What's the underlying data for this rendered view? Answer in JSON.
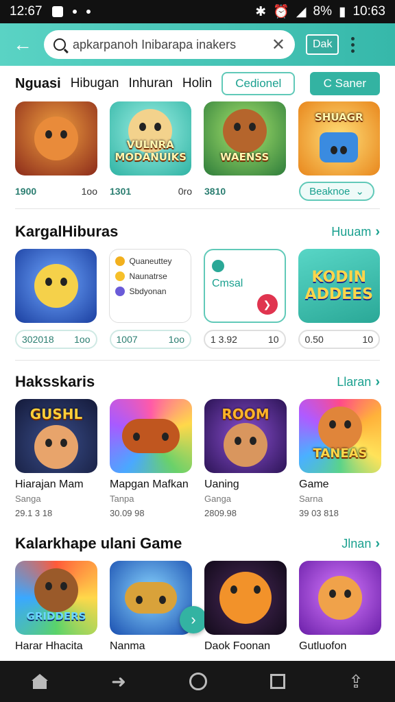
{
  "status_bar": {
    "time": "12:67",
    "right_time": "10:63",
    "battery": "8%"
  },
  "app_bar": {
    "search_text": "apkarpanoh Inibarapa inakers",
    "data_label": "Dak"
  },
  "top_section": {
    "title": "Nguasi",
    "tabs": [
      "Hibugan",
      "Inhuran",
      "Holin"
    ],
    "pill_outline": "Cedionel",
    "pill_solid": "C Saner",
    "games": [
      {
        "icon": "fox-mascot-icon",
        "bg": "#c23b2b",
        "banner": ""
      },
      {
        "icon": "puppy-mascot-icon",
        "bg": "#4ccbc0",
        "banner": "VULNRA MODANUIKS"
      },
      {
        "icon": "bear-mascot-icon",
        "bg": "#56a83a",
        "banner": "WAENSS"
      },
      {
        "icon": "robot-console-icon",
        "bg": "#f6a21b",
        "banner": "SHUAGR"
      }
    ],
    "meta": [
      {
        "value": "1900",
        "count": "1oo"
      },
      {
        "value": "1301",
        "count": "0ro"
      },
      {
        "value": "3810",
        "count": ""
      }
    ],
    "dropdown_label": "Beaknoe"
  },
  "section_kargal": {
    "title": "KargalHiburas",
    "see_all": "Huuam",
    "list_card_items": [
      "Quaneuttey",
      "Naunatrse",
      "Sbdyonan"
    ],
    "green_card_text": "Cmsal",
    "logo_card_text": "KODIN ADDEES",
    "chips": [
      {
        "value": "302018",
        "count": "1oo"
      },
      {
        "value": "1007",
        "count": "1oo"
      },
      {
        "value": "1 3.92",
        "count": "10"
      },
      {
        "value": "0.50",
        "count": "10"
      }
    ]
  },
  "section_hakss": {
    "title": "Haksskaris",
    "see_all": "Llaran",
    "games": [
      {
        "icon": "kids-group-icon",
        "bg": "#1f2a55",
        "banner": "GUSHL",
        "title": "Hiarajan Mam",
        "sub": "Sanga",
        "size": "29.1 3 18"
      },
      {
        "icon": "gamepad-icon",
        "bg": "#9a4bd6",
        "banner": "",
        "title": "Mapgan Mafkan",
        "sub": "Tanpa",
        "size": "30.09 98"
      },
      {
        "icon": "police-duo-icon",
        "bg": "#5b2a86",
        "banner": "ROOM",
        "title": "Uaning",
        "sub": "Ganga",
        "size": "2809.98"
      },
      {
        "icon": "bear-dancer-icon",
        "bg": "#e6377a",
        "banner": "TANEAS",
        "title": "Game",
        "sub": "Sarna",
        "size": "39 03 818"
      }
    ]
  },
  "section_kalar": {
    "title": "Kalarkhape ulani Game",
    "see_all": "Jlnan",
    "games": [
      {
        "icon": "bear-pilot-icon",
        "bg": "#e8402f",
        "banner": "GRIDDERS",
        "title": "Harar Hhacita"
      },
      {
        "icon": "ufo-icon",
        "bg": "#2a7fd4",
        "banner": "",
        "title": "Nanma"
      },
      {
        "icon": "orange-blob-icon",
        "bg": "#2b1c36",
        "banner": "",
        "title": "Daok Foonan"
      },
      {
        "icon": "cat-hero-icon",
        "bg": "#a03fcf",
        "banner": "",
        "title": "Gutluofon"
      }
    ]
  },
  "colors": {
    "accent": "#33b3a2",
    "accent_light": "#5ad3c4"
  }
}
